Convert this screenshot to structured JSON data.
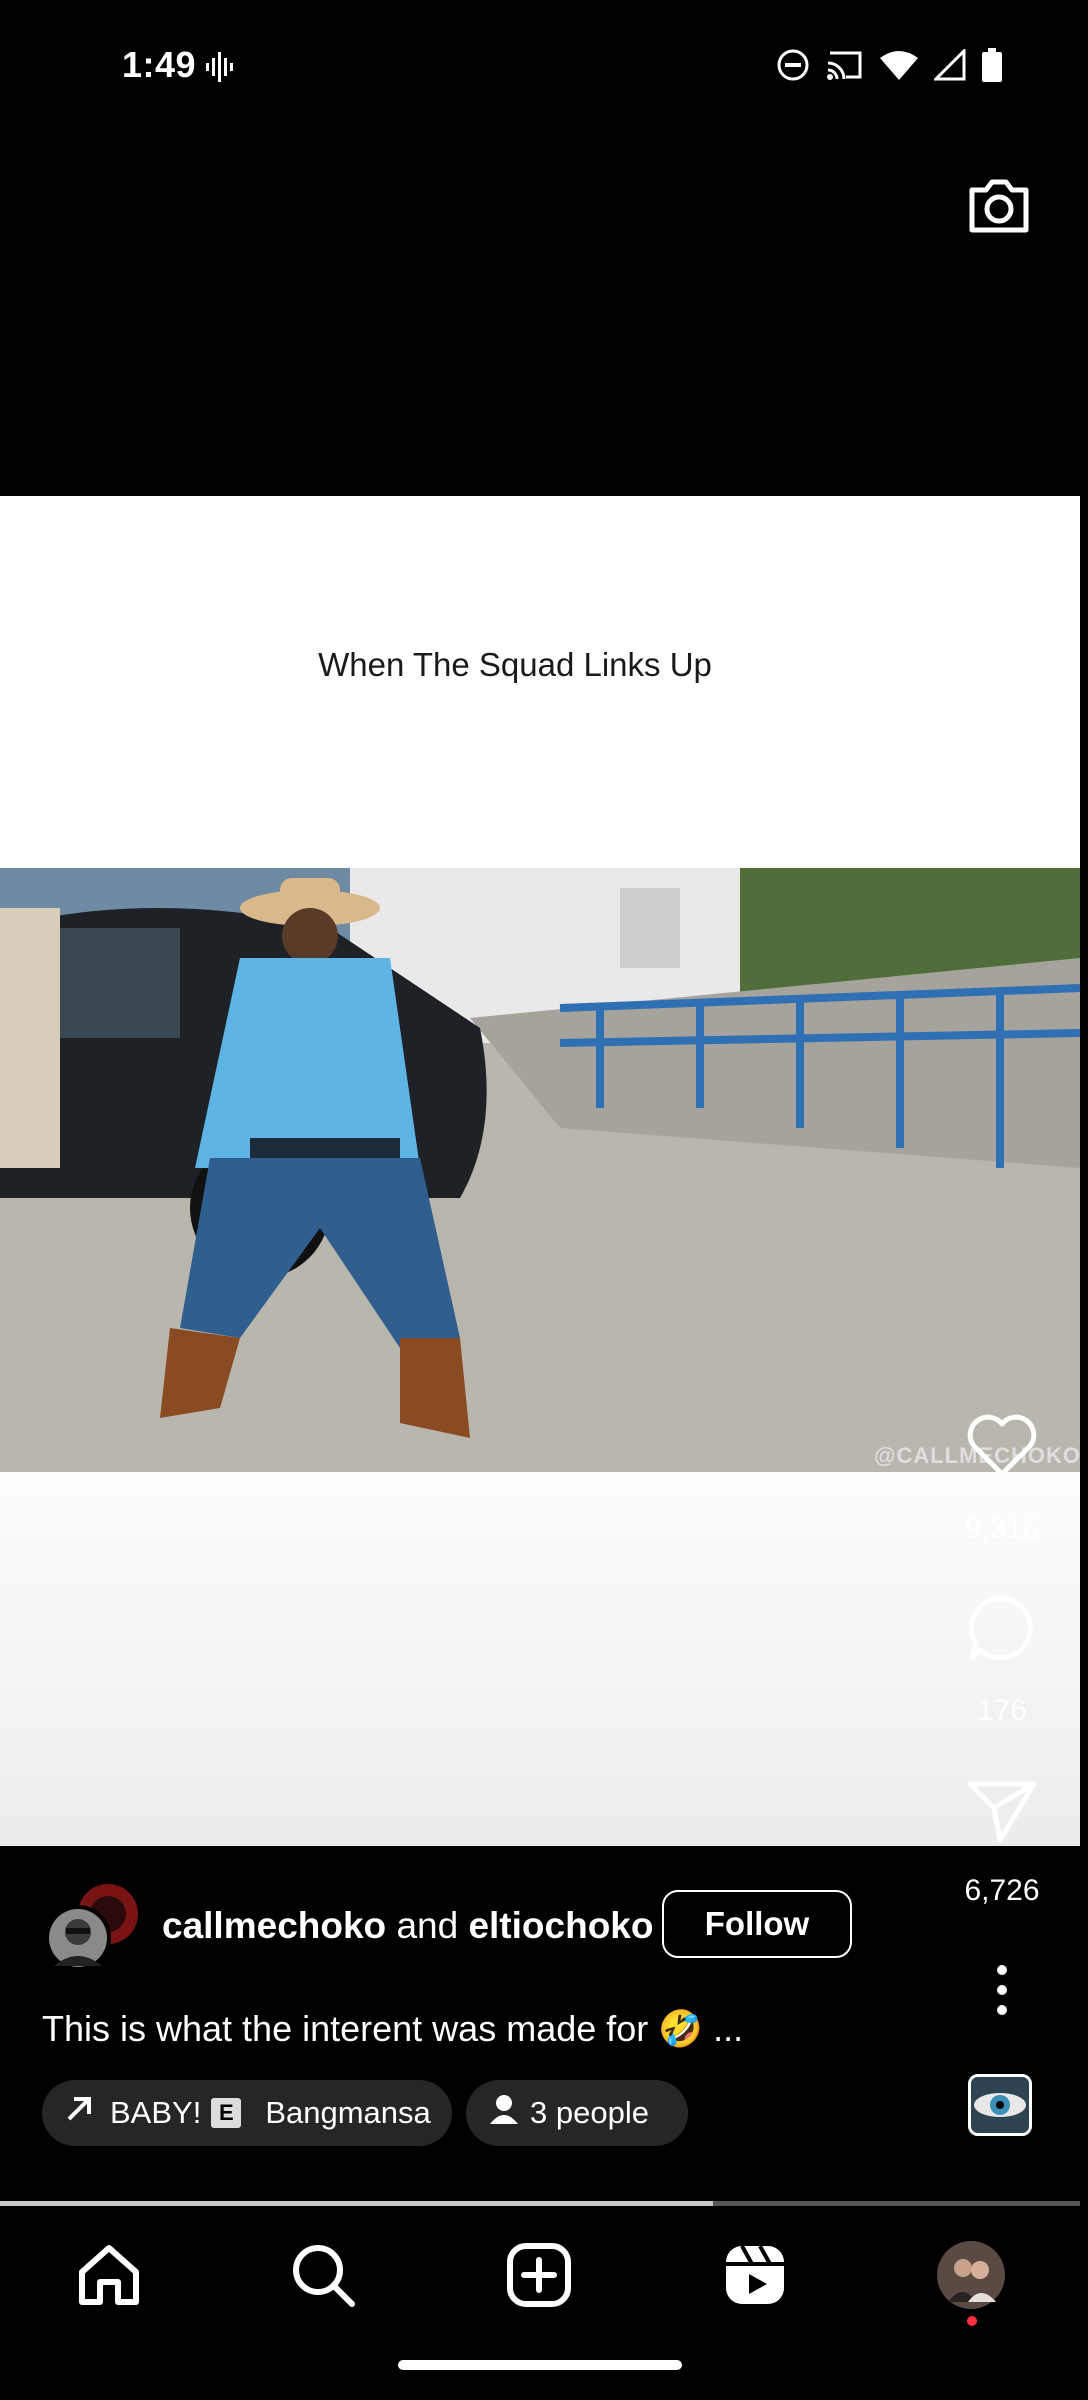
{
  "status_bar": {
    "time": "1:49",
    "icons": [
      "audio-wave-icon",
      "dnd-icon",
      "cast-icon",
      "wifi-icon",
      "signal-icon",
      "battery-icon"
    ]
  },
  "video": {
    "caption": "When The Squad Links Up",
    "watermark": "@CALLMECHOKO"
  },
  "actions": {
    "likes": "9,316",
    "comments": "176",
    "shares": "6,726"
  },
  "post": {
    "user1": "callmechoko",
    "and_text": "and",
    "user2": "eltiochoko",
    "follow_label": "Follow",
    "description": "This is what the interent was made for 🤣 ...",
    "music_song": "BABY!",
    "music_badge": "E",
    "music_artist": "Bangmansa",
    "people_label": "3 people"
  },
  "progress": {
    "fraction": 0.66
  },
  "nav": {
    "items": [
      "home-icon",
      "search-icon",
      "create-icon",
      "reels-icon",
      "profile-avatar"
    ],
    "notification_dot_color": "#ff3040"
  }
}
